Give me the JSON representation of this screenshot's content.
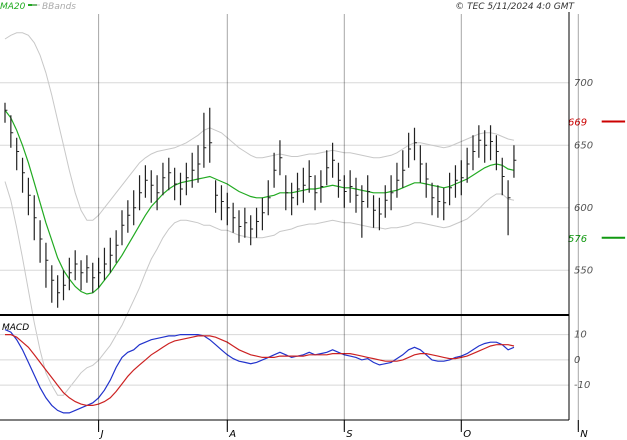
{
  "header": {
    "legend_ma": "MA20",
    "legend_bb": "BBands",
    "copyright": "© TEC 5/11/2024 4:0 GMT"
  },
  "macd_panel": {
    "title": "MACD"
  },
  "colors": {
    "price_bar": "#222222",
    "ma20": "#22aa22",
    "bbands": "#c8c8c8",
    "resistance": "#cc0000",
    "support": "#119911",
    "macd": "#2233cc",
    "signal": "#cc2222",
    "axis_text": "#555555",
    "grid": "#d8d8d8",
    "frame": "#000000"
  },
  "chart_data": [
    {
      "type": "ohlc",
      "name": "price",
      "x_labels": [
        "J",
        "A",
        "S",
        "O",
        "N"
      ],
      "x_label_positions": [
        16,
        38,
        58,
        78,
        98
      ],
      "ylim": [
        515,
        755
      ],
      "y_ticks": [
        550,
        600,
        650,
        700
      ],
      "y_tick_labels": [
        "550",
        "600",
        "650",
        "700"
      ],
      "resistance": {
        "value": 669,
        "label": "669",
        "x_range": [
          102,
          106
        ]
      },
      "support": {
        "value": 576,
        "label": "576",
        "x_range": [
          102,
          106
        ]
      },
      "close": [
        678,
        660,
        645,
        628,
        610,
        592,
        575,
        558,
        542,
        532,
        538,
        548,
        555,
        548,
        552,
        544,
        548,
        555,
        562,
        570,
        586,
        594,
        600,
        612,
        622,
        618,
        612,
        624,
        628,
        619,
        615,
        624,
        630,
        635,
        648,
        652,
        610,
        605,
        600,
        592,
        585,
        588,
        583,
        589,
        596,
        608,
        630,
        640,
        612,
        608,
        615,
        618,
        625,
        612,
        617,
        632,
        638,
        622,
        613,
        617,
        610,
        605,
        613,
        598,
        595,
        606,
        612,
        622,
        630,
        647,
        652,
        635,
        623,
        608,
        605,
        604,
        616,
        622,
        624,
        635,
        645,
        654,
        650,
        653,
        645,
        625,
        608,
        638
      ],
      "high": [
        684,
        674,
        656,
        640,
        624,
        610,
        590,
        572,
        554,
        546,
        550,
        560,
        566,
        558,
        562,
        556,
        560,
        568,
        576,
        582,
        598,
        606,
        614,
        626,
        634,
        630,
        626,
        636,
        640,
        632,
        628,
        636,
        644,
        650,
        676,
        680,
        622,
        618,
        612,
        604,
        598,
        600,
        594,
        600,
        608,
        622,
        644,
        654,
        626,
        620,
        628,
        632,
        638,
        626,
        630,
        646,
        652,
        636,
        626,
        630,
        624,
        618,
        626,
        610,
        608,
        618,
        626,
        636,
        646,
        660,
        664,
        650,
        636,
        620,
        618,
        616,
        628,
        634,
        638,
        648,
        658,
        666,
        662,
        666,
        658,
        640,
        622,
        650
      ],
      "low": [
        668,
        648,
        630,
        612,
        594,
        574,
        556,
        536,
        524,
        520,
        526,
        534,
        542,
        534,
        540,
        532,
        536,
        542,
        548,
        556,
        570,
        580,
        586,
        598,
        608,
        604,
        598,
        610,
        614,
        606,
        602,
        610,
        616,
        620,
        632,
        636,
        596,
        590,
        586,
        580,
        572,
        576,
        570,
        576,
        582,
        594,
        616,
        626,
        598,
        594,
        602,
        604,
        612,
        598,
        604,
        618,
        624,
        608,
        600,
        604,
        596,
        576,
        600,
        584,
        582,
        592,
        598,
        608,
        616,
        632,
        638,
        620,
        608,
        594,
        592,
        590,
        602,
        608,
        610,
        620,
        630,
        640,
        636,
        638,
        630,
        610,
        578,
        624
      ],
      "ma20": [
        678,
        672,
        662,
        650,
        636,
        620,
        604,
        588,
        574,
        560,
        550,
        543,
        537,
        533,
        531,
        532,
        536,
        542,
        548,
        555,
        562,
        570,
        578,
        586,
        594,
        601,
        606,
        611,
        615,
        618,
        620,
        621,
        622,
        623,
        624,
        625,
        623,
        621,
        619,
        616,
        613,
        611,
        609,
        608,
        608,
        609,
        610,
        612,
        612,
        612,
        613,
        614,
        615,
        615,
        616,
        617,
        618,
        617,
        616,
        616,
        615,
        614,
        613,
        612,
        612,
        612,
        613,
        614,
        616,
        618,
        620,
        620,
        619,
        618,
        617,
        616,
        617,
        619,
        621,
        623,
        626,
        629,
        632,
        634,
        635,
        634,
        631,
        630
      ],
      "bb_upper": [
        735,
        738,
        740,
        740,
        738,
        732,
        722,
        708,
        690,
        670,
        650,
        630,
        612,
        598,
        590,
        590,
        594,
        600,
        606,
        612,
        618,
        624,
        630,
        636,
        640,
        643,
        645,
        646,
        647,
        648,
        650,
        652,
        655,
        658,
        662,
        664,
        662,
        660,
        656,
        652,
        648,
        645,
        642,
        640,
        640,
        641,
        642,
        643,
        642,
        641,
        641,
        642,
        643,
        643,
        644,
        645,
        646,
        645,
        644,
        644,
        643,
        642,
        641,
        640,
        640,
        641,
        642,
        644,
        647,
        650,
        652,
        652,
        651,
        650,
        649,
        648,
        649,
        651,
        653,
        655,
        657,
        659,
        660,
        660,
        659,
        657,
        655,
        654
      ],
      "bb_lower": [
        621,
        606,
        584,
        560,
        534,
        508,
        486,
        468,
        458,
        450,
        450,
        456,
        462,
        468,
        472,
        474,
        478,
        484,
        490,
        498,
        506,
        516,
        526,
        536,
        548,
        559,
        567,
        576,
        583,
        588,
        590,
        590,
        589,
        588,
        586,
        586,
        584,
        582,
        582,
        580,
        578,
        577,
        576,
        576,
        576,
        577,
        578,
        581,
        582,
        583,
        585,
        586,
        587,
        587,
        588,
        589,
        590,
        589,
        588,
        588,
        587,
        586,
        585,
        584,
        584,
        583,
        584,
        584,
        585,
        586,
        588,
        588,
        587,
        586,
        585,
        584,
        585,
        587,
        589,
        591,
        595,
        599,
        604,
        608,
        611,
        611,
        607,
        606
      ]
    },
    {
      "type": "line",
      "name": "macd",
      "ylim": [
        -23,
        15
      ],
      "y_ticks": [
        10,
        0,
        -10
      ],
      "y_tick_labels": [
        "10",
        "0",
        "-10"
      ],
      "series": [
        {
          "name": "MACD",
          "values": [
            12,
            11,
            8,
            4,
            -1,
            -6,
            -11,
            -15,
            -18,
            -20,
            -21,
            -21,
            -20,
            -19,
            -18,
            -17,
            -15,
            -12,
            -8,
            -3,
            1,
            3,
            4,
            6,
            7,
            8,
            8.5,
            9,
            9.5,
            9.5,
            10,
            10,
            10,
            10,
            9.5,
            8,
            6,
            4,
            2,
            0.5,
            -0.5,
            -1,
            -1.5,
            -1,
            0,
            1,
            2,
            3,
            2,
            1,
            1.5,
            2,
            3,
            2,
            2.5,
            3,
            4,
            3,
            2,
            1.5,
            1,
            0,
            0.5,
            -1,
            -2,
            -1.5,
            -1,
            0.5,
            2,
            4,
            5,
            4,
            2,
            0,
            -0.5,
            -0.5,
            0,
            1,
            1.5,
            2.5,
            4,
            5.5,
            6.5,
            7,
            7,
            6,
            4,
            5
          ]
        },
        {
          "name": "Signal",
          "values": [
            10,
            10,
            9,
            7,
            5,
            2,
            -1,
            -4,
            -7,
            -10,
            -13,
            -15,
            -16.5,
            -17.5,
            -18,
            -18,
            -17.5,
            -16.5,
            -15,
            -12.5,
            -9.5,
            -6.5,
            -4,
            -2,
            0,
            2,
            3.5,
            5,
            6.5,
            7.5,
            8,
            8.5,
            9,
            9.5,
            9.5,
            9.5,
            9,
            8,
            7,
            5.5,
            4,
            3,
            2,
            1.5,
            1,
            1,
            1,
            1.5,
            1.5,
            1.5,
            1.5,
            1.5,
            2,
            2,
            2,
            2,
            2.5,
            2.5,
            2.5,
            2.5,
            2,
            1.5,
            1,
            0.5,
            0,
            -0.5,
            -0.5,
            -0.5,
            0,
            1,
            2,
            2.5,
            2.5,
            2,
            1.5,
            1,
            0.5,
            0.5,
            1,
            1.5,
            2.5,
            3.5,
            4.5,
            5.5,
            6,
            6,
            6,
            5.5
          ]
        }
      ]
    }
  ]
}
